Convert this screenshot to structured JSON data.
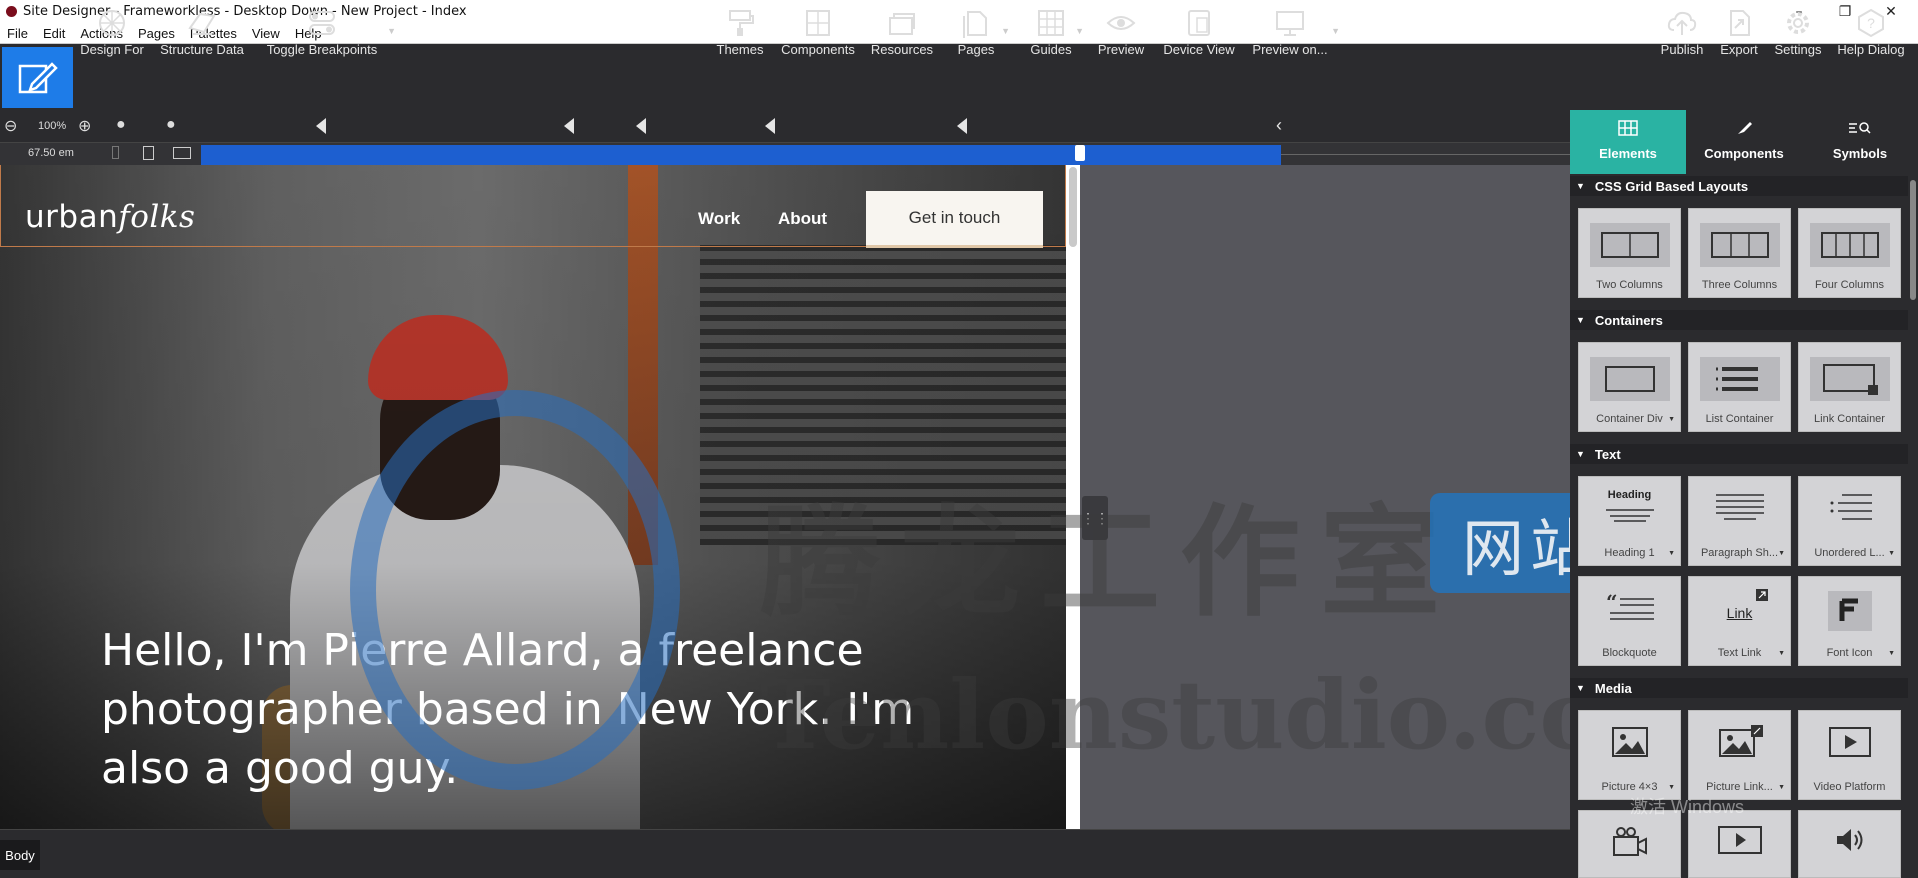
{
  "window": {
    "title": "Site Designer - Frameworkless - Desktop Down - New Project - Index",
    "controls": [
      "–",
      "❐",
      "✕"
    ]
  },
  "menubar": [
    "File",
    "Edit",
    "Actions",
    "Pages",
    "Palettes",
    "View",
    "Help"
  ],
  "toolbar": {
    "left": [
      {
        "label": "Design For",
        "icon": "design-for-icon"
      },
      {
        "label": "Structure Data",
        "icon": "structure-data-icon"
      },
      {
        "label": "Toggle Breakpoints",
        "icon": "toggle-breakpoints-icon"
      }
    ],
    "center": [
      {
        "label": "Themes",
        "icon": "themes-icon"
      },
      {
        "label": "Components",
        "icon": "components-icon"
      },
      {
        "label": "Resources",
        "icon": "resources-icon"
      },
      {
        "label": "Pages",
        "icon": "pages-icon"
      },
      {
        "label": "Guides",
        "icon": "guides-icon"
      },
      {
        "label": "Preview",
        "icon": "preview-icon"
      },
      {
        "label": "Device View",
        "icon": "device-view-icon"
      },
      {
        "label": "Preview on...",
        "icon": "preview-on-icon"
      }
    ],
    "right": [
      {
        "label": "Publish",
        "icon": "publish-icon"
      },
      {
        "label": "Export",
        "icon": "export-icon"
      },
      {
        "label": "Settings",
        "icon": "settings-icon"
      },
      {
        "label": "Help Dialog",
        "icon": "help-dialog-icon"
      }
    ]
  },
  "zoom": {
    "value": "100%",
    "em_width": "67.50 em"
  },
  "canvas_page": {
    "brand_regular": "urban",
    "brand_italic": "folks",
    "nav": [
      "Work",
      "About"
    ],
    "cta": "Get in touch",
    "hero_text": "Hello, I'm Pierre Allard, a freelance photographer based in New York. I'm also a good guy."
  },
  "watermark": {
    "cn": "腾龙工作室",
    "en": "Tenlonstudio.com",
    "box": "网站"
  },
  "statusbar": {
    "crumb": "Body"
  },
  "panel": {
    "tabs": [
      {
        "label": "Elements",
        "icon": "grid-icon"
      },
      {
        "label": "Components",
        "icon": "brush-icon"
      },
      {
        "label": "Symbols",
        "icon": "search-list-icon"
      }
    ],
    "sections": [
      {
        "title": "CSS Grid Based Layouts",
        "items": [
          "Two Columns",
          "Three Columns",
          "Four Columns"
        ]
      },
      {
        "title": "Containers",
        "items": [
          "Container Div",
          "List Container",
          "Link Container"
        ]
      },
      {
        "title": "Text",
        "items": [
          "Heading 1",
          "Paragraph Sh...",
          "Unordered L...",
          "Blockquote",
          "Text Link",
          "Font Icon"
        ]
      },
      {
        "title": "Media",
        "items": [
          "Picture 4×3",
          "Picture Link...",
          "Video Platform"
        ]
      }
    ],
    "tile_texts": {
      "heading_thumb": "Heading",
      "link_thumb": "Link"
    }
  },
  "overlay": {
    "activate_windows": "激活 Windows"
  },
  "colors": {
    "accent_blue": "#1e7ce8",
    "panel_teal": "#2ab3a3",
    "toolbar_bg": "#2b2b2e"
  }
}
